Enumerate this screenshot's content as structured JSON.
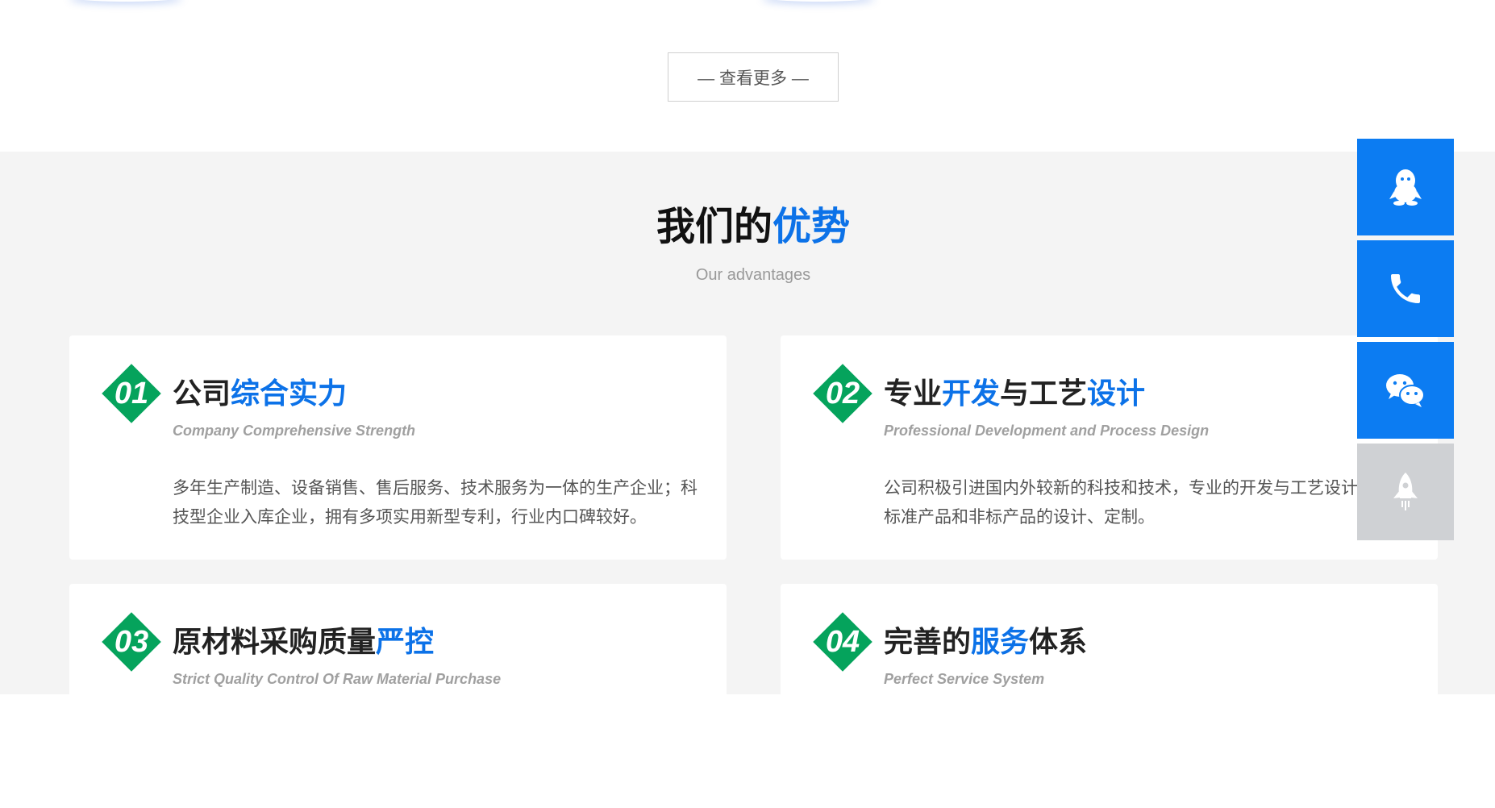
{
  "more": {
    "label": "— 查看更多 —"
  },
  "advantages": {
    "title_black": "我们的",
    "title_blue": "优势",
    "subtitle": "Our advantages",
    "cards": [
      {
        "num": "01",
        "title_dark": "公司",
        "title_blue": "综合实力",
        "title_dark_2": "",
        "title_blue_2": "",
        "subtitle": "Company Comprehensive Strength",
        "desc": "多年生产制造、设备销售、售后服务、技术服务为一体的生产企业；科技型企业入库企业，拥有多项实用新型专利，行业内口碑较好。"
      },
      {
        "num": "02",
        "title_dark": "专业",
        "title_blue": "开发",
        "title_dark_2": "与工艺",
        "title_blue_2": "设计",
        "subtitle": "Professional Development and Process Design",
        "desc": "公司积极引进国内外较新的科技和技术，专业的开发与工艺设计，提供标准产品和非标产品的设计、定制。"
      },
      {
        "num": "03",
        "title_dark": "原材料采购质量",
        "title_blue": "严控",
        "title_dark_2": "",
        "title_blue_2": "",
        "subtitle": "Strict Quality Control Of Raw Material Purchase",
        "desc": ""
      },
      {
        "num": "04",
        "title_dark": "完善的",
        "title_blue": "服务",
        "title_dark_2": "体系",
        "title_blue_2": "",
        "subtitle": "Perfect Service System",
        "desc": ""
      }
    ]
  },
  "float_bar": {
    "icons": [
      "qq-icon",
      "phone-icon",
      "wechat-icon",
      "rocket-icon"
    ],
    "colors": {
      "primary": "#0c7cf2",
      "inactive": "#cfd1d4",
      "badge": "#05a35c",
      "accent_text": "#0c72e8"
    }
  }
}
